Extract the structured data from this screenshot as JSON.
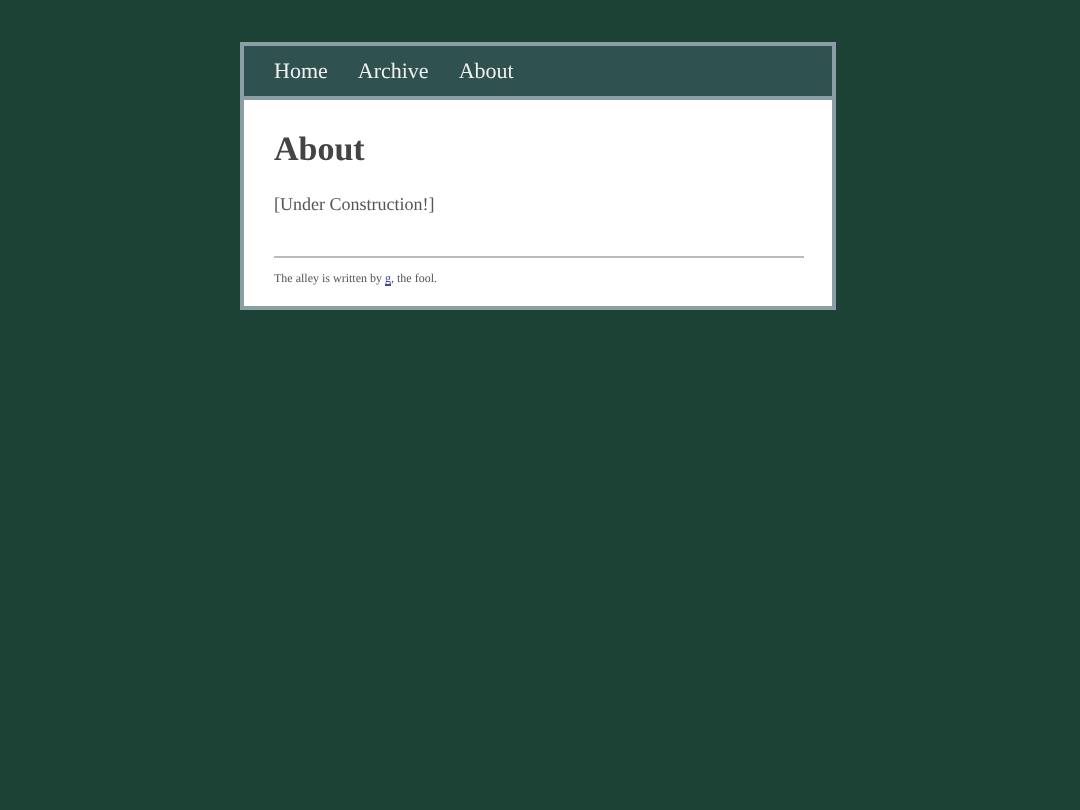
{
  "nav": [
    "Home",
    "Archive",
    "About"
  ],
  "heading": "About",
  "body": "[Under Construction!]",
  "footer": {
    "before": "The alley is written by ",
    "link": "g",
    "after": ", the fool."
  }
}
